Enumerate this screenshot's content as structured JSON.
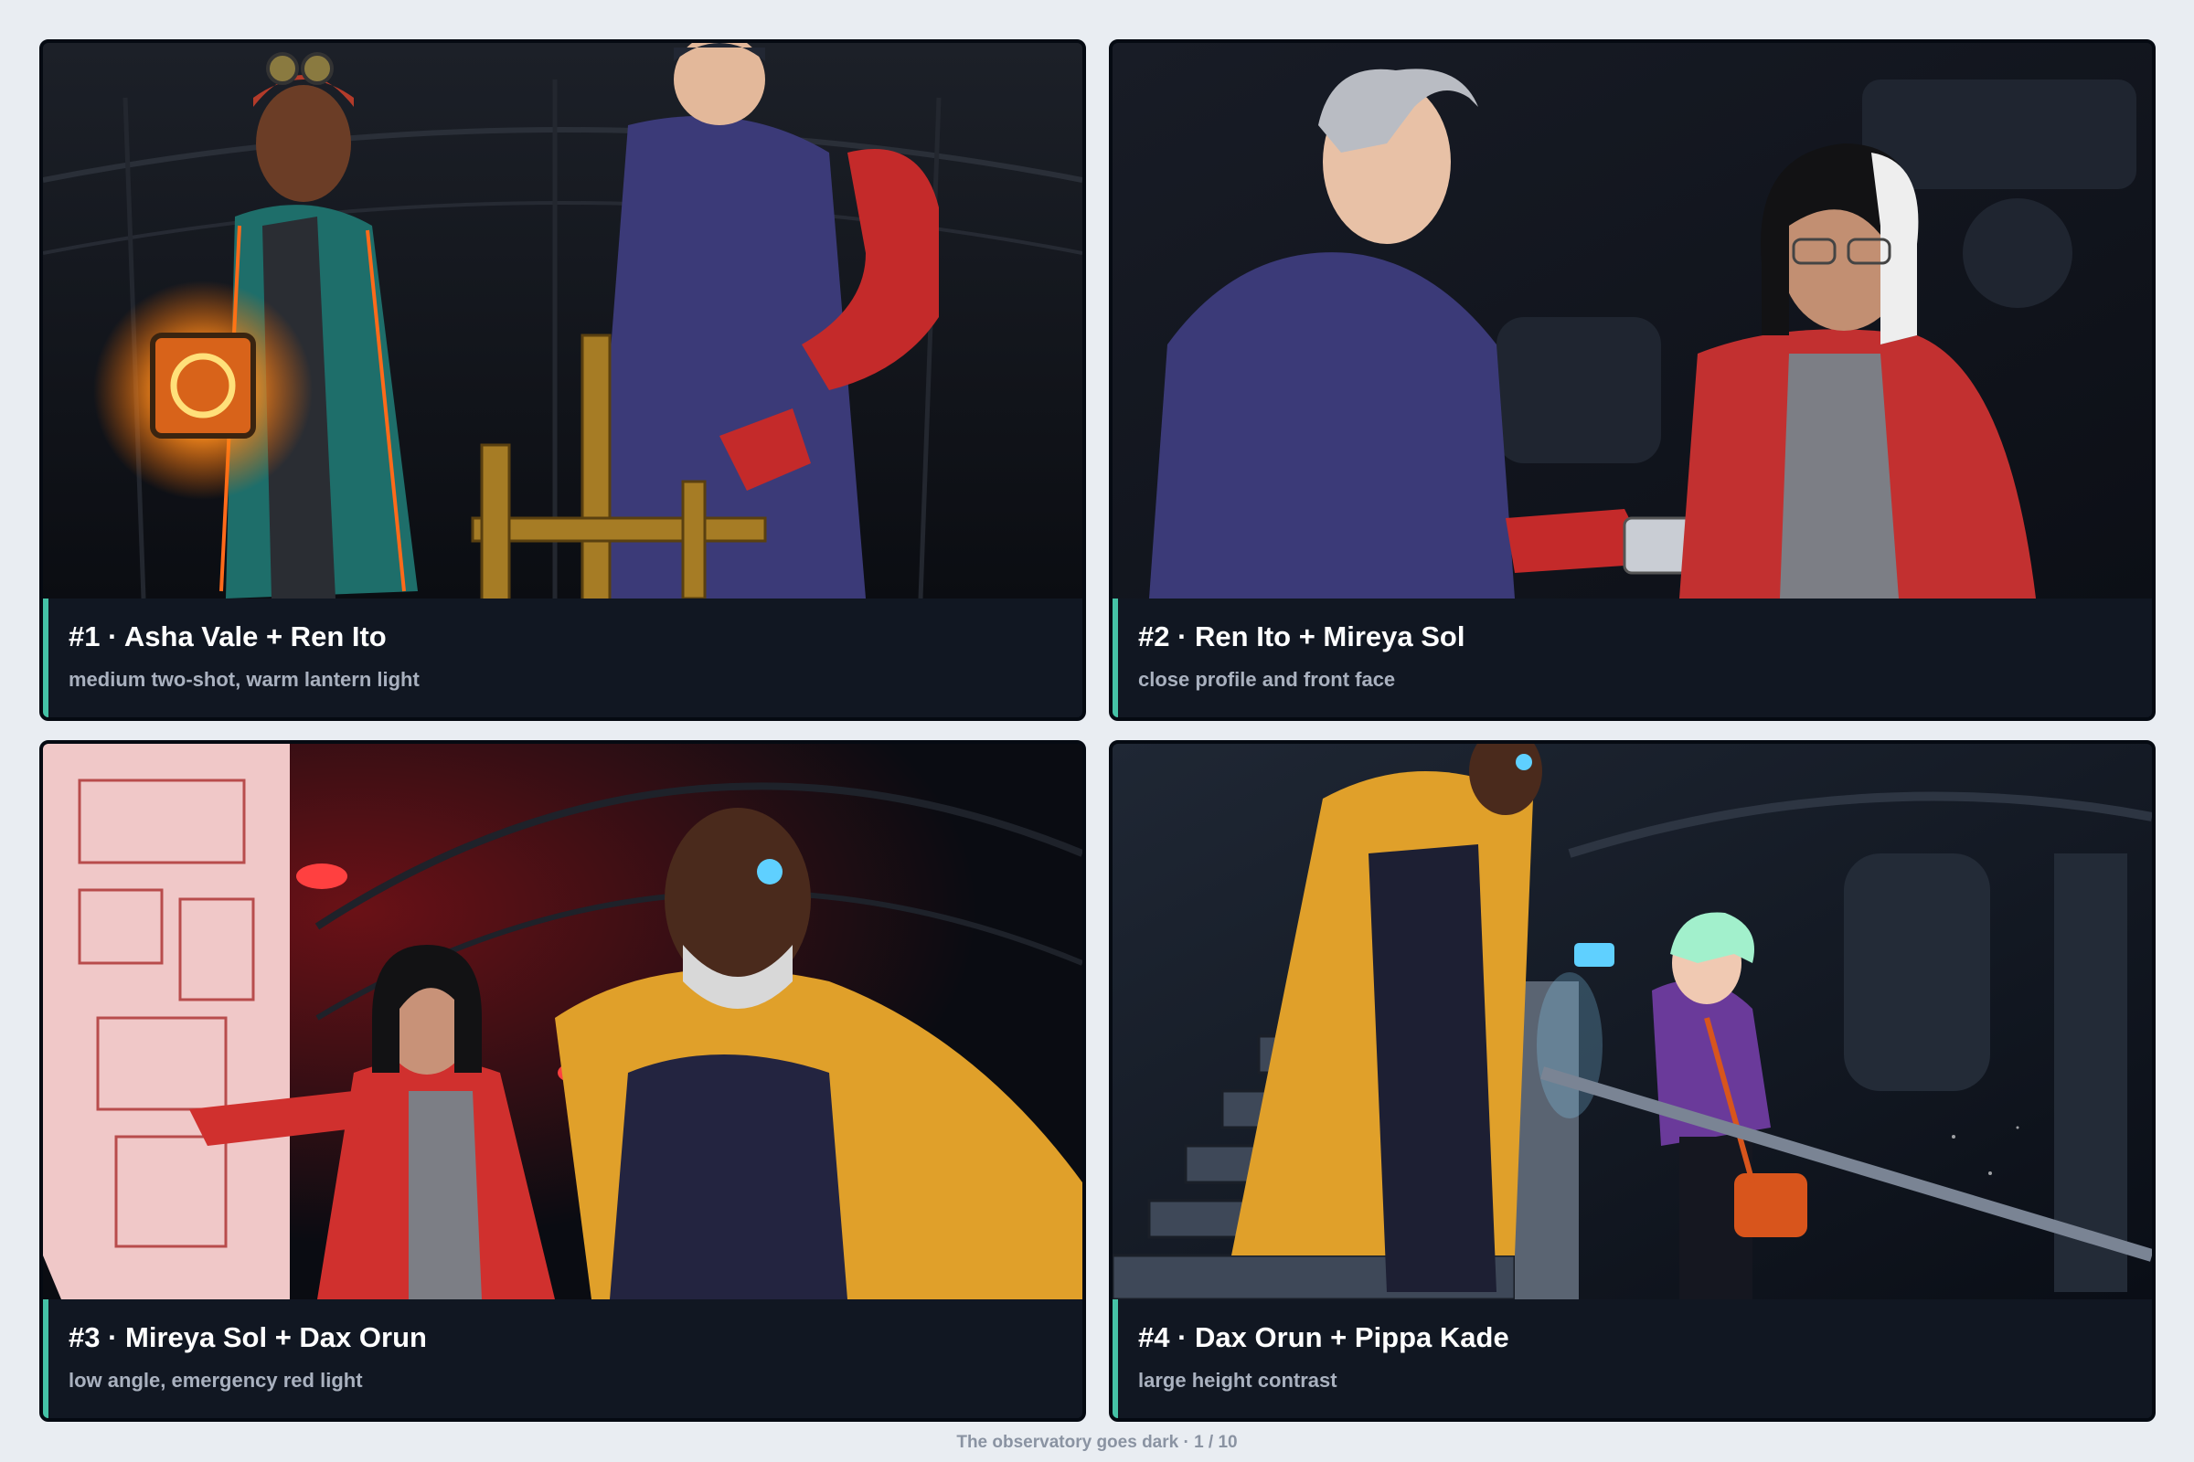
{
  "panels": [
    {
      "title": "#1 · Asha Vale + Ren Ito",
      "subtitle": "medium two-shot, warm lantern light",
      "accent": "#45c2a6",
      "illustration": "asha-ren-illustration"
    },
    {
      "title": "#2 · Ren Ito + Mireya Sol",
      "subtitle": "close profile and front face",
      "accent": "#45c2a6",
      "illustration": "ren-mireya-illustration"
    },
    {
      "title": "#3 · Mireya Sol + Dax Orun",
      "subtitle": "low angle, emergency red light",
      "accent": "#45c2a6",
      "illustration": "mireya-dax-illustration"
    },
    {
      "title": "#4 · Dax Orun + Pippa Kade",
      "subtitle": "large height contrast",
      "accent": "#45c2a6",
      "illustration": "dax-pippa-illustration"
    }
  ],
  "footer": "The observatory goes dark · 1 / 10"
}
